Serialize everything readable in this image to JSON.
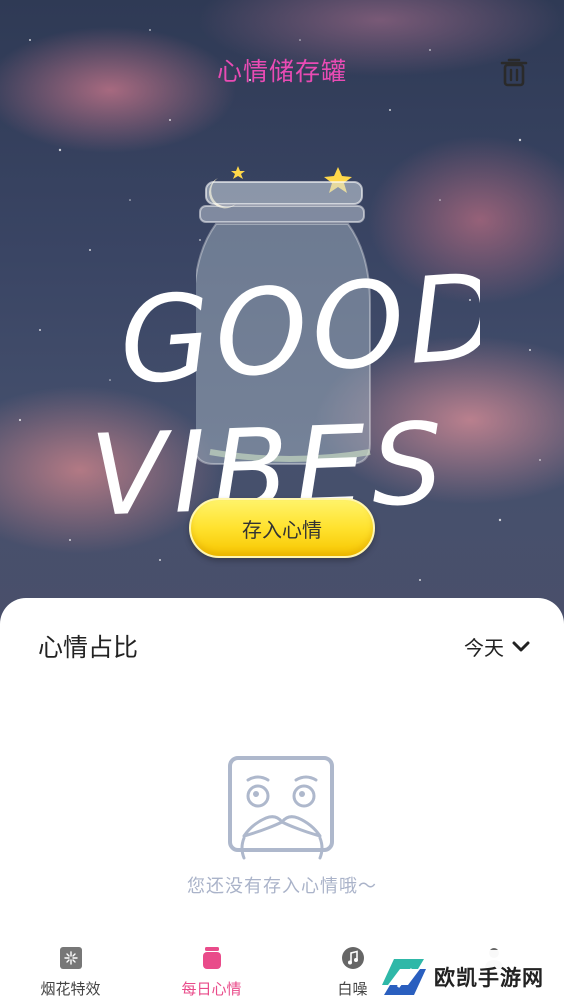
{
  "header": {
    "title": "心情储存罐",
    "trash_icon": "trash-icon"
  },
  "hero": {
    "art_text_line1": "GOOD",
    "art_text_line2": "VIBES",
    "save_button_label": "存入心情"
  },
  "card": {
    "title": "心情占比",
    "period_selected": "今天",
    "empty_message": "您还没有存入心情哦～"
  },
  "tabbar": {
    "items": [
      {
        "label": "烟花特效",
        "icon": "fireworks-icon"
      },
      {
        "label": "每日心情",
        "icon": "mood-jar-icon"
      },
      {
        "label": "白噪",
        "icon": "music-icon"
      },
      {
        "label": "",
        "icon": "profile-icon"
      }
    ],
    "active_index": 1
  },
  "watermark": {
    "text": "欧凯手游网"
  },
  "colors": {
    "title_pink": "#e94bb4",
    "active_tab": "#e94b8a",
    "button_yellow": "#ffe22e",
    "empty_text": "#aab3c9"
  }
}
